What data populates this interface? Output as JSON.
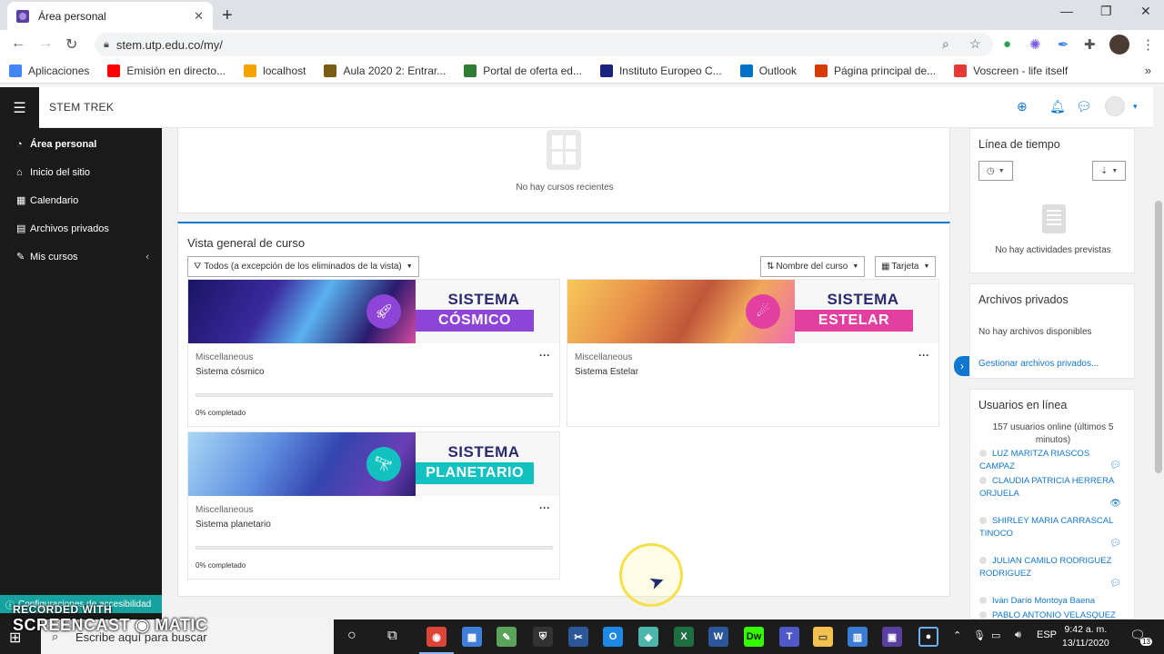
{
  "browser": {
    "tab_title": "Área personal",
    "url": "stem.utp.edu.co/my/",
    "bookmarks": [
      {
        "label": "Aplicaciones",
        "color": "#4285f4"
      },
      {
        "label": "Emisión en directo...",
        "color": "#ff0000"
      },
      {
        "label": "localhost",
        "color": "#f4a300"
      },
      {
        "label": "Aula 2020 2: Entrar...",
        "color": "#7a5c12"
      },
      {
        "label": "Portal de oferta ed...",
        "color": "#2e7d32"
      },
      {
        "label": "Instituto Europeo C...",
        "color": "#1a237e"
      },
      {
        "label": "Outlook",
        "color": "#0072c6"
      },
      {
        "label": "Página principal de...",
        "color": "#d83b01"
      },
      {
        "label": "Voscreen - life itself",
        "color": "#e53935"
      }
    ]
  },
  "navbar": {
    "site_name": "STEM TREK"
  },
  "drawer": {
    "items": [
      {
        "label": "Área personal",
        "icon": "dashboard-icon",
        "glyph": "◔"
      },
      {
        "label": "Inicio del sitio",
        "icon": "home-icon",
        "glyph": "⌂"
      },
      {
        "label": "Calendario",
        "icon": "calendar-icon",
        "glyph": "▦"
      },
      {
        "label": "Archivos privados",
        "icon": "file-icon",
        "glyph": "▤"
      },
      {
        "label": "Mis cursos",
        "icon": "graduation-cap-icon",
        "glyph": "✎"
      }
    ],
    "accessibility": "Configuraciones de accesibilidad"
  },
  "recent": {
    "empty": "No hay cursos recientes"
  },
  "overview": {
    "title": "Vista general de curso",
    "filter": "Todos (a excepción de los eliminados de la vista)",
    "sort": "Nombre del curso",
    "view": "Tarjeta",
    "courses": [
      {
        "category": "Miscellaneous",
        "name": "Sistema cósmico",
        "progress": "0% completado",
        "progress_value": 0,
        "banner_l1": "SISTEMA",
        "banner_l2": "CÓSMICO",
        "accent": "#8e44d6",
        "art": "linear-gradient(120deg,#1b1464 0%,#3a2a9e 35%,#5ab2f0 55%,#2a1a6e 80%,#d64aa0 100%)"
      },
      {
        "category": "Miscellaneous",
        "name": "Sistema Estelar",
        "progress": "",
        "progress_value": null,
        "banner_l1": "SISTEMA",
        "banner_l2": "ESTELAR",
        "accent": "#e23fa0",
        "art": "linear-gradient(120deg,#f7c85a 0%,#e8914a 30%,#c0563a 55%,#f0a85a 75%,#f26cb0 100%)"
      },
      {
        "category": "Miscellaneous",
        "name": "Sistema planetario",
        "progress": "0% completado",
        "progress_value": 0,
        "banner_l1": "SISTEMA",
        "banner_l2": "PLANETARIO",
        "accent": "#12c2c0",
        "art": "linear-gradient(120deg,#a8d8f5 0%,#5f8fe0 35%,#3445b0 60%,#6a3fb5 85%,#2a1e70 100%)"
      }
    ]
  },
  "timeline": {
    "title": "Línea de tiempo",
    "empty": "No hay actividades previstas"
  },
  "private_files": {
    "title": "Archivos privados",
    "empty": "No hay archivos disponibles",
    "manage_link": "Gestionar archivos privados..."
  },
  "online_users": {
    "title": "Usuarios en línea",
    "summary": "157 usuarios online (últimos 5 minutos)",
    "users": [
      "LUZ MARITZA RIASCOS CAMPAZ",
      "CLAUDIA PATRICIA HERRERA ORJUELA",
      "SHIRLEY MARIA CARRASCAL TINOCO",
      "JULIAN CAMILO RODRIGUEZ RODRIGUEZ",
      "Iván Darío Montoya Baena",
      "PABLO ANTONIO VELASQUEZ"
    ]
  },
  "taskbar": {
    "search_placeholder": "Escribe aquí para buscar",
    "lang": "ESP",
    "time": "9:42 a. m.",
    "date": "13/11/2020",
    "notifications": "13"
  },
  "watermark": {
    "line1": "RECORDED WITH",
    "line2": "SCREENCAST ◉ MATIC"
  }
}
